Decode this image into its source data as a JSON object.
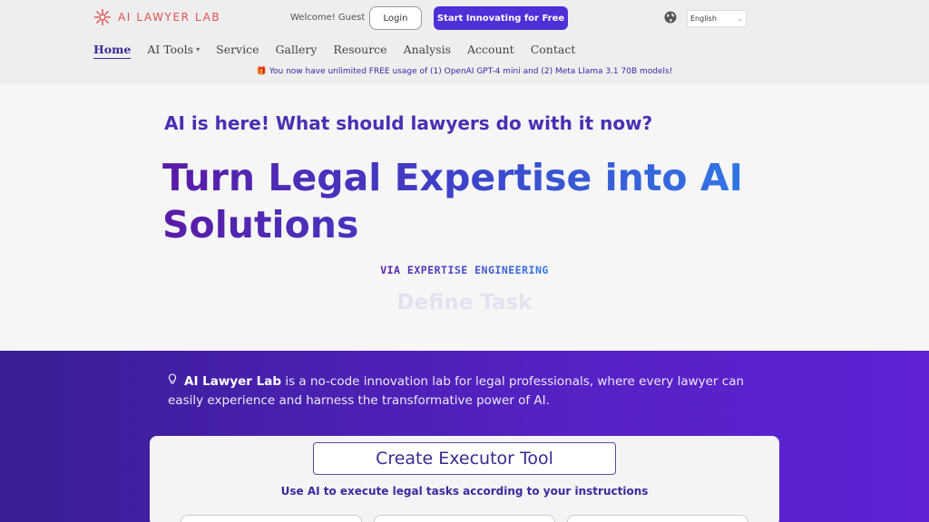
{
  "header": {
    "logo_text": "AI LAWYER LAB",
    "welcome": "Welcome! Guest",
    "login_label": "Login",
    "start_label": "Start Innovating for Free",
    "language": "English",
    "brand_color": "#e0524f",
    "accent_color": "#4e2fd8"
  },
  "nav": {
    "items": [
      {
        "label": "Home",
        "active": true
      },
      {
        "label": "AI Tools",
        "has_dropdown": true
      },
      {
        "label": "Service"
      },
      {
        "label": "Gallery"
      },
      {
        "label": "Resource"
      },
      {
        "label": "Analysis"
      },
      {
        "label": "Account"
      },
      {
        "label": "Contact"
      }
    ]
  },
  "banner": "🎁 You now have unlimited FREE usage of (1) OpenAI GPT-4 mini and (2) Meta Llama 3.1 70B models!",
  "hero": {
    "subtitle": "AI is here! What should lawyers do with it now?",
    "headline": "Turn Legal Expertise into AI Solutions",
    "via": "VIA EXPERTISE ENGINEERING",
    "rotating": "Define Task"
  },
  "intro": {
    "icon": "lightbulb-icon",
    "brand": "AI Lawyer Lab",
    "text": " is a no-code innovation lab for legal professionals, where every lawyer can easily experience and harness the transformative power of AI."
  },
  "card": {
    "button_label": "Create Executor Tool",
    "description": "Use AI to execute legal tasks according to your instructions"
  }
}
